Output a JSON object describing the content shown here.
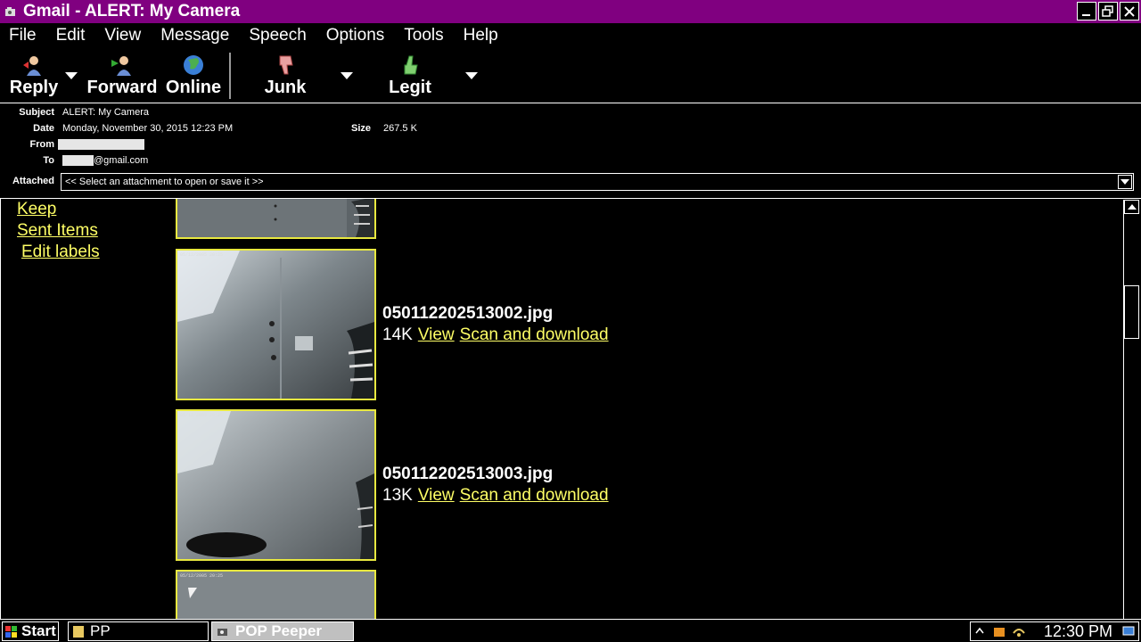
{
  "window": {
    "title": "Gmail - ALERT: My Camera",
    "buttons": [
      "minimize",
      "restore",
      "close"
    ]
  },
  "menu": [
    "File",
    "Edit",
    "View",
    "Message",
    "Speech",
    "Options",
    "Tools",
    "Help"
  ],
  "toolbar": {
    "reply": "Reply",
    "forward": "Forward",
    "online": "Online",
    "junk": "Junk",
    "legit": "Legit"
  },
  "headers": {
    "subject_label": "Subject",
    "subject": "ALERT: My Camera",
    "date_label": "Date",
    "date": "Monday, November 30, 2015 12:23 PM",
    "size_label": "Size",
    "size": "267.5 K",
    "from_label": "From",
    "to_label": "To",
    "to_suffix": "@gmail.com",
    "attached_label": "Attached",
    "attached_placeholder": "<< Select an attachment to open or save it >>"
  },
  "sidebar": {
    "links": [
      "Keep",
      "Sent Items",
      "Edit labels"
    ]
  },
  "attachments": [
    {
      "filename": "050112202513002.jpg",
      "size": "14K",
      "view": "View",
      "scan": "Scan and download"
    },
    {
      "filename": "050112202513003.jpg",
      "size": "13K",
      "view": "View",
      "scan": "Scan and download"
    }
  ],
  "taskbar": {
    "start": "Start",
    "tasks": [
      "PP",
      "POP Peeper"
    ],
    "clock": "12:30 PM"
  },
  "colors": {
    "titlebar": "#800080",
    "link": "#ffff66",
    "thumb_border": "#e8e840",
    "background": "#000000"
  }
}
